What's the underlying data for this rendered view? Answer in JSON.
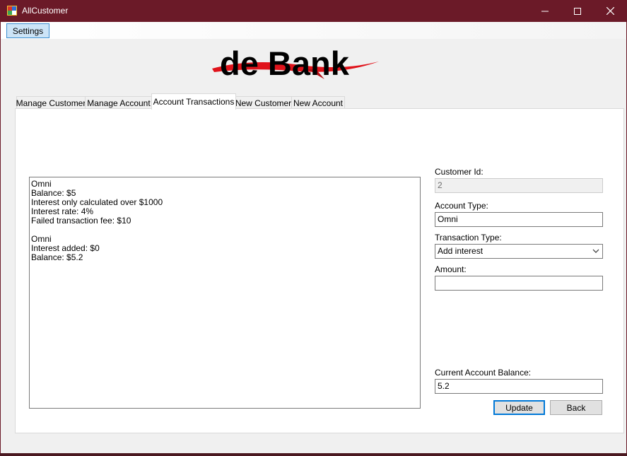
{
  "window": {
    "title": "AllCustomer",
    "controls": [
      "minimize-icon",
      "maximize-icon",
      "close-icon"
    ]
  },
  "menu": {
    "settings_label": "Settings"
  },
  "logo": {
    "text": "de Bank",
    "accent_color": "#e0131b"
  },
  "tabs": [
    {
      "label": "Manage Customer",
      "active": false
    },
    {
      "label": "Manage Account",
      "active": false
    },
    {
      "label": "Account Transactions",
      "active": true
    },
    {
      "label": "New Customer",
      "active": false
    },
    {
      "label": "New Account",
      "active": false
    }
  ],
  "transaction_log": {
    "lines": [
      "Omni",
      "Balance: $5",
      "Interest only calculated over $1000",
      "Interest rate: 4%",
      "Failed transaction fee: $10",
      "",
      "Omni",
      "Interest added: $0",
      "Balance: $5.2"
    ]
  },
  "form": {
    "customer_id_label": "Customer Id:",
    "customer_id_value": "2",
    "account_type_label": "Account Type:",
    "account_type_value": "Omni",
    "transaction_type_label": "Transaction Type:",
    "transaction_type_value": "Add interest",
    "amount_label": "Amount:",
    "amount_value": "",
    "balance_label": "Current Account Balance:",
    "balance_value": "5.2"
  },
  "buttons": {
    "update_label": "Update",
    "back_label": "Back"
  },
  "colors": {
    "titlebar": "#6b1a28",
    "selection": "#cce4f7",
    "focus_border": "#0078d7"
  }
}
